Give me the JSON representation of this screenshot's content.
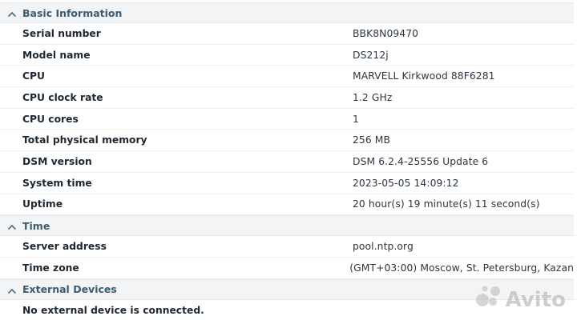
{
  "sections": [
    {
      "title": "Basic Information",
      "rows": [
        {
          "label": "Serial number",
          "value": "BBK8N09470"
        },
        {
          "label": "Model name",
          "value": "DS212j"
        },
        {
          "label": "CPU",
          "value": "MARVELL Kirkwood 88F6281"
        },
        {
          "label": "CPU clock rate",
          "value": "1.2 GHz"
        },
        {
          "label": "CPU cores",
          "value": "1"
        },
        {
          "label": "Total physical memory",
          "value": "256 MB"
        },
        {
          "label": "DSM version",
          "value": "DSM 6.2.4-25556 Update 6"
        },
        {
          "label": "System time",
          "value": "2023-05-05 14:09:12"
        },
        {
          "label": "Uptime",
          "value": "20 hour(s) 19 minute(s) 11 second(s)"
        }
      ]
    },
    {
      "title": "Time",
      "rows": [
        {
          "label": "Server address",
          "value": "pool.ntp.org"
        },
        {
          "label": "Time zone",
          "value": "(GMT+03:00) Moscow, St. Petersburg, Kazan"
        }
      ]
    },
    {
      "title": "External Devices",
      "message": "No external device is connected."
    }
  ],
  "watermark": {
    "text": "Avito"
  },
  "colors": {
    "header_bg": "#f2f4f5",
    "header_text": "#3c5a70",
    "row_border": "#eef0f2"
  },
  "icons": {
    "section_toggle": "chevron-up-icon",
    "watermark": "avito-logo-icon"
  }
}
